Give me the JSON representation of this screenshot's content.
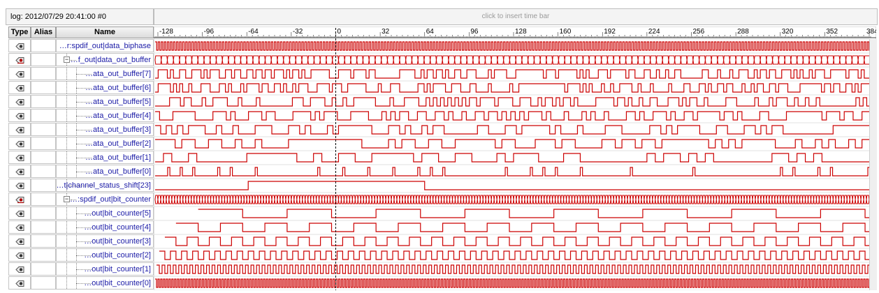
{
  "header": {
    "log_label": "log: 2012/07/29 20:41:00  #0",
    "timebar_hint": "click to insert time bar"
  },
  "columns": {
    "type": "Type",
    "alias": "Alias",
    "name": "Name"
  },
  "timeline": {
    "ticks": [
      "-128",
      "-96",
      "-64",
      "-32",
      "0",
      "32",
      "64",
      "96",
      "128",
      "160",
      "192",
      "224",
      "256",
      "288",
      "320",
      "352",
      "384"
    ],
    "range": [
      -130,
      385
    ],
    "cursor": 0,
    "wave_color": "#cc0000"
  },
  "signals": [
    {
      "name": "…r:spdif_out|data_biphase",
      "kind": "single",
      "indent": 0,
      "pattern": {
        "type": "clock",
        "period": 2.2
      }
    },
    {
      "name": "…f_out|data_out_buffer",
      "kind": "bus",
      "indent": 0,
      "expander": "−",
      "pattern": {
        "type": "bus",
        "period": 4.4
      }
    },
    {
      "name": "…ata_out_buffer[7]",
      "kind": "single",
      "indent": 1,
      "pattern": {
        "type": "random",
        "period": 2.2,
        "seed": 7
      }
    },
    {
      "name": "…ata_out_buffer[6]",
      "kind": "single",
      "indent": 1,
      "pattern": {
        "type": "random",
        "period": 2.2,
        "seed": 6
      }
    },
    {
      "name": "…ata_out_buffer[5]",
      "kind": "single",
      "indent": 1,
      "pattern": {
        "type": "random",
        "period": 2.6,
        "seed": 5
      }
    },
    {
      "name": "…ata_out_buffer[4]",
      "kind": "single",
      "indent": 1,
      "pattern": {
        "type": "random",
        "period": 3.2,
        "seed": 4
      }
    },
    {
      "name": "…ata_out_buffer[3]",
      "kind": "single",
      "indent": 1,
      "pattern": {
        "type": "random",
        "period": 4.0,
        "seed": 3
      }
    },
    {
      "name": "…ata_out_buffer[2]",
      "kind": "single",
      "indent": 1,
      "pattern": {
        "type": "sparse",
        "period": 4.8,
        "seed": 2,
        "prob": 0.55
      }
    },
    {
      "name": "…ata_out_buffer[1]",
      "kind": "single",
      "indent": 1,
      "pattern": {
        "type": "sparse",
        "period": 6.0,
        "seed": 1,
        "prob": 0.5
      }
    },
    {
      "name": "…ata_out_buffer[0]",
      "kind": "single",
      "indent": 1,
      "pattern": {
        "type": "pulses",
        "period": 9.0,
        "seed": 11,
        "prob": 0.45
      }
    },
    {
      "name": "…t|channel_status_shift[23]",
      "kind": "single",
      "indent": 0,
      "pattern": {
        "type": "window",
        "high_from": -63,
        "high_to": 64
      }
    },
    {
      "name": "…:spdif_out|bit_counter",
      "kind": "bus",
      "indent": 0,
      "expander": "−",
      "pattern": {
        "type": "bus",
        "period": 2.0
      }
    },
    {
      "name": "…out|bit_counter[5]",
      "kind": "single",
      "indent": 1,
      "pattern": {
        "type": "square",
        "period": 64,
        "phase": -99
      }
    },
    {
      "name": "…out|bit_counter[4]",
      "kind": "single",
      "indent": 1,
      "pattern": {
        "type": "square",
        "period": 32,
        "phase": -115
      }
    },
    {
      "name": "…out|bit_counter[3]",
      "kind": "single",
      "indent": 1,
      "pattern": {
        "type": "square",
        "period": 16,
        "phase": -123
      }
    },
    {
      "name": "…out|bit_counter[2]",
      "kind": "single",
      "indent": 1,
      "pattern": {
        "type": "square",
        "period": 8,
        "phase": -127
      }
    },
    {
      "name": "…out|bit_counter[1]",
      "kind": "single",
      "indent": 1,
      "pattern": {
        "type": "square",
        "period": 4,
        "phase": -129
      }
    },
    {
      "name": "…out|bit_counter[0]",
      "kind": "single",
      "indent": 1,
      "pattern": {
        "type": "square",
        "period": 2,
        "phase": -130
      }
    }
  ],
  "icons": {
    "single": "signal-icon",
    "bus": "bus-signal-icon"
  }
}
